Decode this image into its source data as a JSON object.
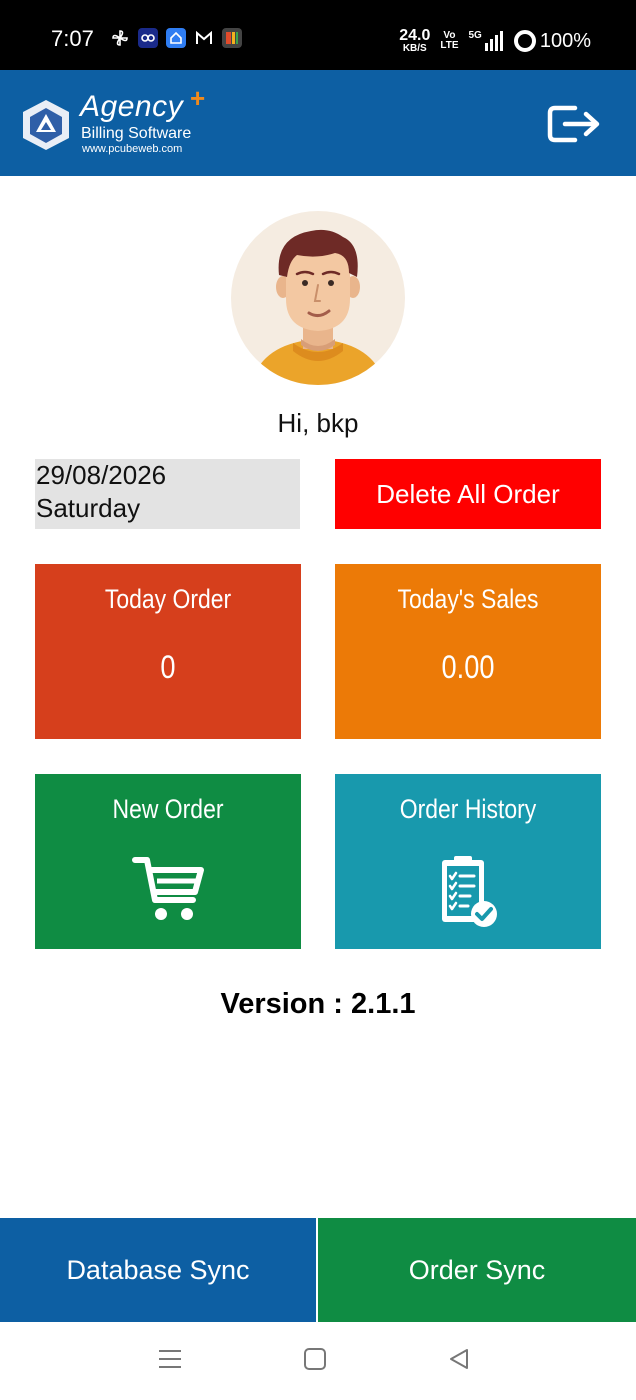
{
  "status_bar": {
    "time": "7:07",
    "net_speed": "24.0",
    "net_unit": "KB/S",
    "volte_top": "Vo",
    "volte_bottom": "LTE",
    "signal_label": "5G",
    "battery": "100%",
    "icons": [
      "pinwheel-icon",
      "link-icon",
      "home-app-icon",
      "gmail-icon",
      "grid-app-icon"
    ]
  },
  "header": {
    "logo_title": "Agency",
    "logo_plus": "+",
    "logo_subtitle": "Billing Software",
    "logo_website": "www.pcubeweb.com",
    "logout_icon": "logout-icon"
  },
  "profile": {
    "greeting": "Hi, bkp"
  },
  "date_box": {
    "date": "29/08/2026",
    "weekday": "Saturday"
  },
  "delete_button": {
    "label": "Delete All Order"
  },
  "tiles": {
    "today_order": {
      "title": "Today Order",
      "value": "0"
    },
    "today_sales": {
      "title": "Today's Sales",
      "value": "0.00"
    },
    "new_order": {
      "title": "New Order",
      "icon": "cart-icon"
    },
    "order_history": {
      "title": "Order History",
      "icon": "clipboard-check-icon"
    }
  },
  "version": {
    "text": "Version : 2.1.1"
  },
  "sync": {
    "database_label": "Database Sync",
    "order_label": "Order Sync"
  },
  "colors": {
    "brand_blue": "#0d5fa3",
    "delete_red": "#ff0000",
    "today_order": "#d63f1c",
    "today_sales": "#ec7a07",
    "green": "#0f8c43",
    "teal": "#1899ad"
  }
}
